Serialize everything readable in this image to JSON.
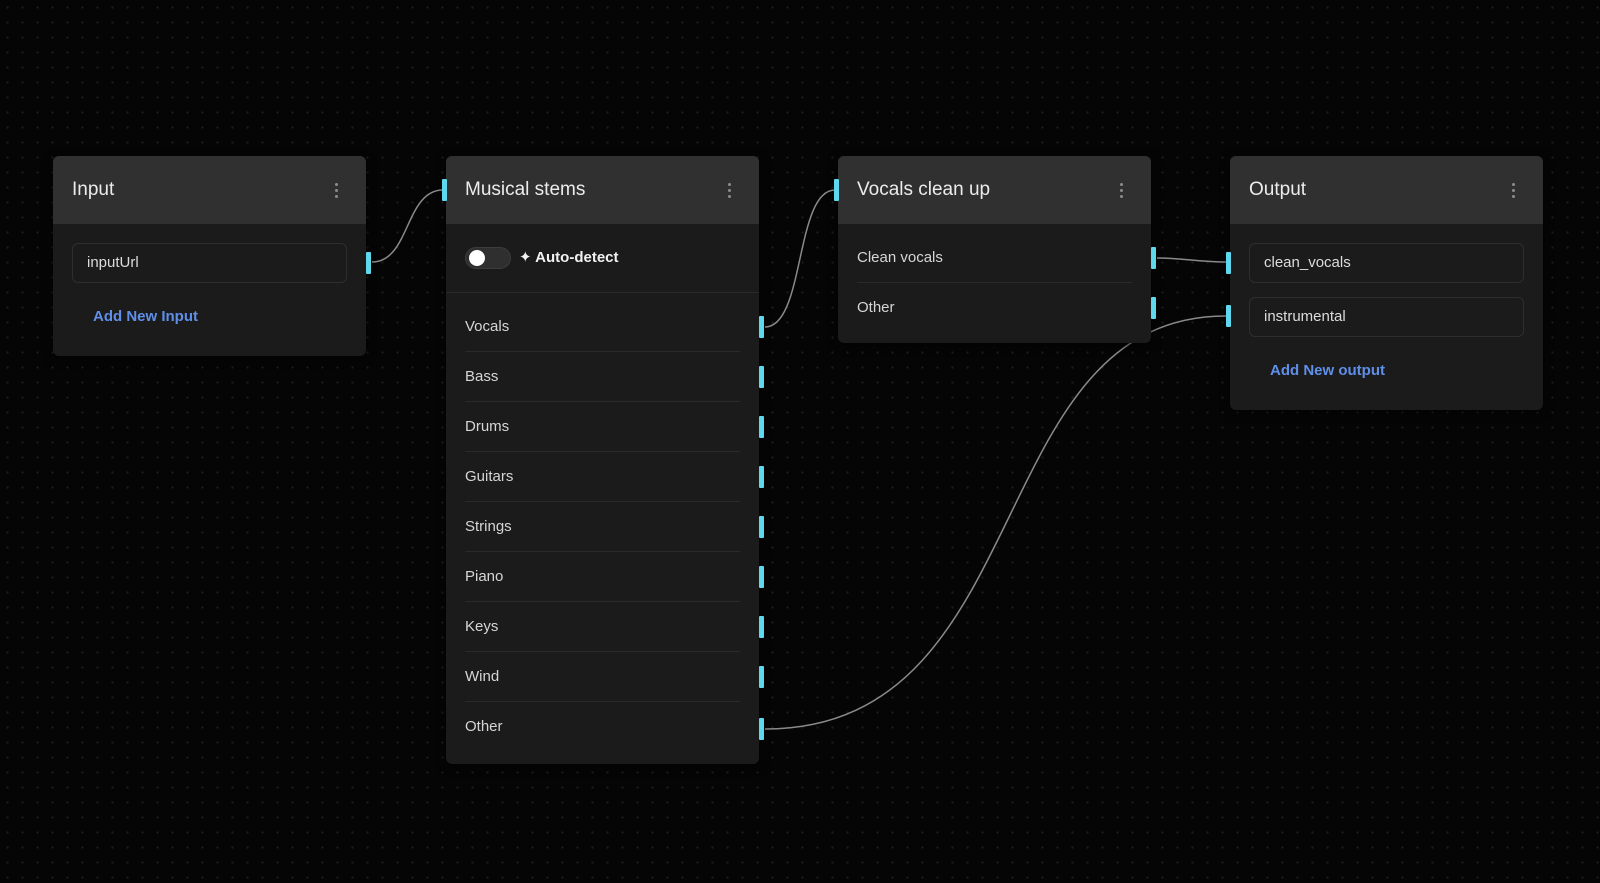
{
  "nodes": {
    "input": {
      "title": "Input",
      "fields": [
        "inputUrl"
      ],
      "add_label": "Add New Input"
    },
    "stems": {
      "title": "Musical stems",
      "toggle_label": "✦ Auto-detect",
      "toggle_on": false,
      "rows": [
        "Vocals",
        "Bass",
        "Drums",
        "Guitars",
        "Strings",
        "Piano",
        "Keys",
        "Wind",
        "Other"
      ]
    },
    "cleanup": {
      "title": "Vocals clean up",
      "rows": [
        "Clean vocals",
        "Other"
      ]
    },
    "output": {
      "title": "Output",
      "fields": [
        "clean_vocals",
        "instrumental"
      ],
      "add_label": "Add New output"
    }
  },
  "theme": {
    "port_color": "#5fd8ee",
    "link_color": "#5f8fe8",
    "wire_color": "#8a8a8a"
  },
  "connections": [
    {
      "from": "input.inputUrl",
      "to": "stems.in"
    },
    {
      "from": "stems.Vocals",
      "to": "cleanup.in"
    },
    {
      "from": "cleanup.Clean vocals",
      "to": "output.clean_vocals"
    },
    {
      "from": "stems.Other",
      "to": "output.instrumental"
    }
  ]
}
